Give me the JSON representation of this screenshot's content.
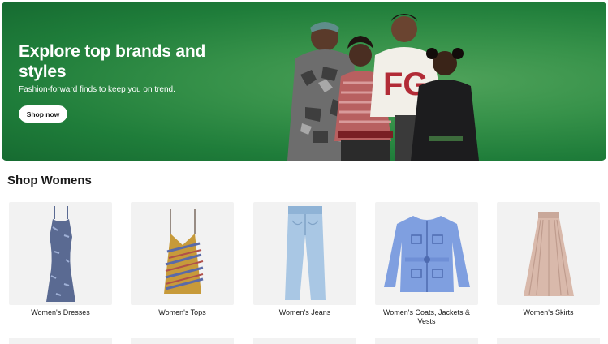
{
  "hero": {
    "title": "Explore top brands and styles",
    "subtitle": "Fashion-forward finds to keep you on trend.",
    "cta_label": "Shop now",
    "background_color": "#2f8a45",
    "art_letters": "FG"
  },
  "section": {
    "title": "Shop Womens"
  },
  "categories": [
    {
      "label": "Women's Dresses",
      "icon": "dress-icon"
    },
    {
      "label": "Women's Tops",
      "icon": "top-icon"
    },
    {
      "label": "Women's Jeans",
      "icon": "jeans-icon"
    },
    {
      "label": "Women's Coats, Jackets & Vests",
      "icon": "coat-icon"
    },
    {
      "label": "Women's Skirts",
      "icon": "skirt-icon"
    }
  ]
}
